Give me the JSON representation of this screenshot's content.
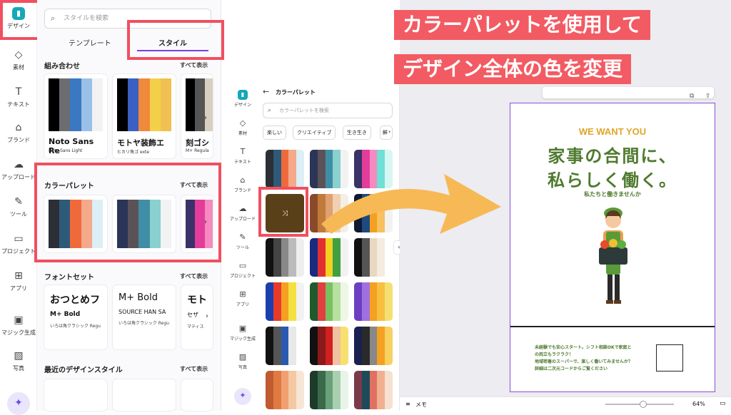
{
  "rail": {
    "items": [
      "デザイン",
      "素材",
      "テキスト",
      "ブランド",
      "アップロード",
      "ツール",
      "プロジェクト",
      "アプリ",
      "マジック生成",
      "写真"
    ]
  },
  "panel1": {
    "search_placeholder": "スタイルを検索",
    "tab_templates": "テンプレート",
    "tab_styles": "スタイル",
    "combos_title": "組み合わせ",
    "see_all": "すべて表示",
    "combo_cards": [
      {
        "font_big": "Noto Sans Re",
        "font_small": "Noto Sans Light"
      },
      {
        "font_big": "モトヤ装飾エ",
        "font_small": "ヒカリ角ゴ exte"
      },
      {
        "font_big": "刻ゴシ",
        "font_small": "M+ Regula"
      }
    ],
    "palette_title": "カラーパレット",
    "fontset_title": "フォントセット",
    "font_cards": [
      {
        "big": "おつとめフ",
        "mid": "M+ Bold",
        "small": "いろは角クラシック Regu"
      },
      {
        "big": "M+ Bold",
        "mid": "SOURCE HAN SA",
        "small": "いろは角クラシック Regu"
      },
      {
        "big": "モト",
        "mid": "セザ",
        "small": "マティス"
      }
    ],
    "recent_title": "最近のデザインスタイル"
  },
  "rail2": {
    "items": [
      "デザイン",
      "素材",
      "テキスト",
      "ブランド",
      "アップロード",
      "ツール",
      "プロジェクト",
      "アプリ",
      "マジック生成",
      "写真"
    ]
  },
  "panel2": {
    "back_title": "カラーパレット",
    "search_placeholder": "カラーパレットを検索",
    "chips": [
      "楽しい",
      "クリエイティブ",
      "生き生き",
      "鮮"
    ]
  },
  "banner": {
    "line1": "カラーパレットを使用して",
    "line2": "デザイン全体の色を変更"
  },
  "design": {
    "tagline": "WE WANT YOU",
    "headline1": "家事の合間に、",
    "headline2": "私らしく働く。",
    "sub": "私たちと働きませんか",
    "body1": "未経験でも安心スタート。シフト相談OKで家庭と",
    "body2": "の両立もラクラク！",
    "body3": "地域密着のスーパーで、楽しく働いてみませんか？",
    "body4": "詳細は二次元コードからご覧ください"
  },
  "bottombar": {
    "memo": "メモ",
    "zoom": "64%"
  },
  "colors": {
    "accent_red": "#f25b63",
    "purple": "#7b3fe4",
    "green": "#4e7a2e",
    "gold": "#e0a528",
    "arrow": "#f7b955"
  }
}
